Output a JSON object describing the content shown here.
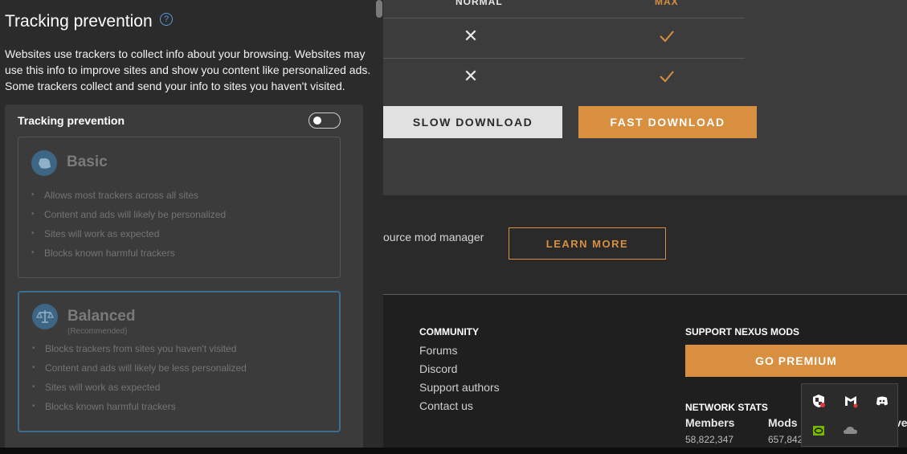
{
  "site": {
    "table": {
      "col1_header": "NORMAL",
      "col2_header": "MAX",
      "rows": [
        {
          "col1": "✕",
          "col2": "check"
        },
        {
          "col1": "✕",
          "col2": "check"
        }
      ]
    },
    "buttons": {
      "slow": "SLOW DOWNLOAD",
      "fast": "FAST DOWNLOAD",
      "learn_more": "LEARN MORE",
      "premium": "GO PREMIUM"
    },
    "promo_text": "ource mod manager",
    "footer": {
      "community_heading": "COMMUNITY",
      "community_links": [
        "Forums",
        "Discord",
        "Support authors",
        "Contact us"
      ],
      "support_heading": "SUPPORT NEXUS MODS",
      "stats_heading": "NETWORK STATS",
      "stats": [
        {
          "label": "Members",
          "value": "58,822,347"
        },
        {
          "label": "Mods",
          "value": "657,842"
        }
      ],
      "cut_label": "ve"
    },
    "colors": {
      "accent": "#d98f40",
      "light_button": "#e1e1e1"
    }
  },
  "panel": {
    "title": "Tracking prevention",
    "help_icon": "?",
    "description": "Websites use trackers to collect info about your browsing. Websites may use this info to improve sites and show you content like personalized ads. Some trackers collect and send your info to sites you haven't visited.",
    "toggle_label": "Tracking prevention",
    "toggle_on": false,
    "options": [
      {
        "title": "Basic",
        "subtitle": "",
        "icon": "basic-shield-icon",
        "bullets": [
          "Allows most trackers across all sites",
          "Content and ads will likely be personalized",
          "Sites will work as expected",
          "Blocks known harmful trackers"
        ]
      },
      {
        "title": "Balanced",
        "subtitle": "(Recommended)",
        "icon": "balance-scale-icon",
        "bullets": [
          "Blocks trackers from sites you haven't visited",
          "Content and ads will likely be less personalized",
          "Sites will work as expected",
          "Blocks known harmful trackers"
        ]
      }
    ],
    "colors": {
      "selected_border": "#3d6d8f",
      "link": "#5b9bd5"
    }
  },
  "tray": {
    "icons": [
      "security-shield-icon",
      "mcafee-icon",
      "discord-icon",
      "nvidia-icon",
      "onedrive-cloud-icon"
    ]
  }
}
